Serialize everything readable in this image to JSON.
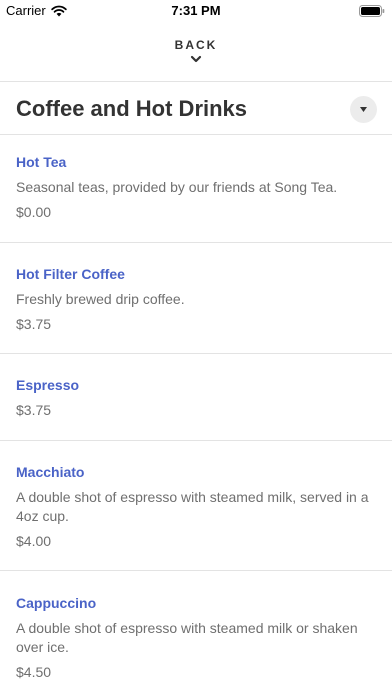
{
  "status_bar": {
    "carrier": "Carrier",
    "time": "7:31 PM"
  },
  "nav": {
    "back_label": "BACK"
  },
  "section": {
    "title": "Coffee and Hot Drinks"
  },
  "items": [
    {
      "name": "Hot Tea",
      "description": "Seasonal teas, provided by our friends at Song Tea.",
      "price": "$0.00"
    },
    {
      "name": "Hot Filter Coffee",
      "description": "Freshly brewed drip coffee.",
      "price": "$3.75"
    },
    {
      "name": "Espresso",
      "price": "$3.75"
    },
    {
      "name": "Macchiato",
      "description": "A double shot of espresso with steamed milk, served in a 4oz cup.",
      "price": "$4.00"
    },
    {
      "name": "Cappuccino",
      "description": "A double shot of espresso with steamed milk or shaken over ice.",
      "price": "$4.50"
    }
  ],
  "colors": {
    "accent": "#4a63c7",
    "text_dark": "#333333",
    "text_muted": "#6f6f6f",
    "divider": "#e3e3e3"
  }
}
